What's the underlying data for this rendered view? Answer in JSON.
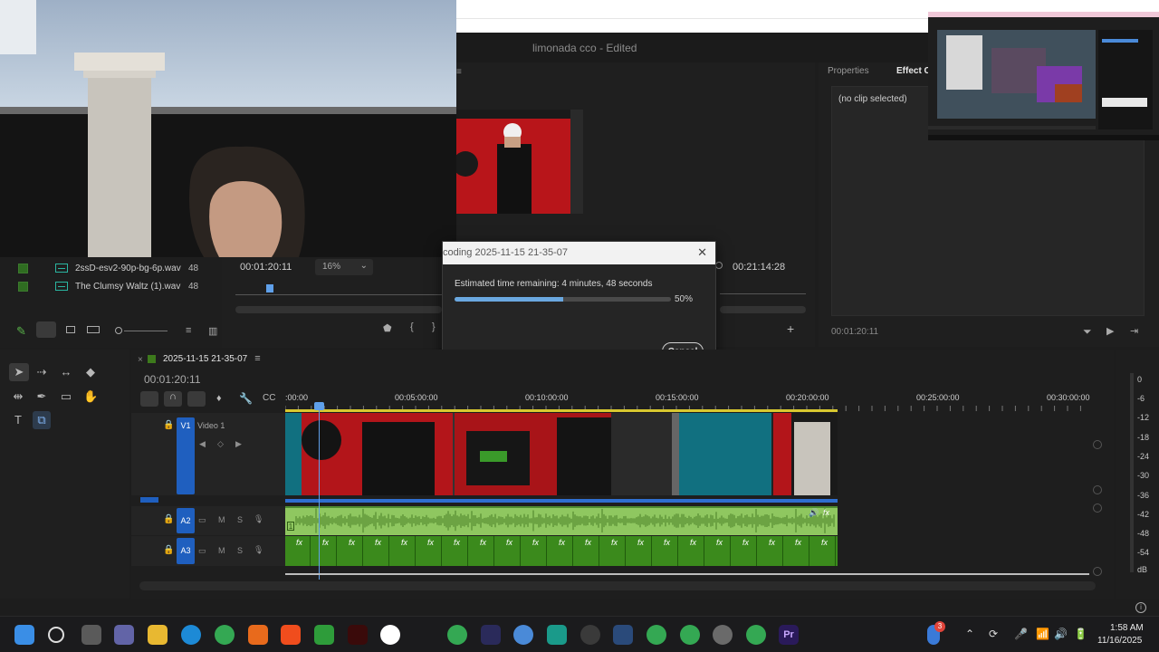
{
  "app": {
    "document_title": "limonada cco",
    "document_state": "- Edited"
  },
  "project": {
    "items": [
      {
        "name": "2ssD-esv2-90p-bg-6p.wav",
        "extra": "48"
      },
      {
        "name": "The Clumsy Waltz (1).wav",
        "extra": "48"
      }
    ]
  },
  "source_monitor": {
    "timecode": "00:01:20:11",
    "zoom": "16%"
  },
  "program_monitor": {
    "end_timecode": "00:21:14:28"
  },
  "properties": {
    "tabs": [
      "Properties",
      "Effect Co"
    ],
    "empty_message": "(no clip selected)",
    "timecode": "00:01:20:11"
  },
  "dialog": {
    "title": "coding 2025-11-15 21-35-07",
    "eta": "Estimated time remaining: 4 minutes, 48 seconds",
    "progress": 0.5,
    "progress_label": "50%",
    "cancel_label": "Cancel"
  },
  "timeline": {
    "sequence_name": "2025-11-15 21-35-07",
    "timecode": "00:01:20:11",
    "ruler_labels": [
      ":00:00",
      "00:05:00:00",
      "00:10:00:00",
      "00:15:00:00",
      "00:20:00:00",
      "00:25:00:00",
      "00:30:00:00"
    ],
    "tracks": {
      "v1": {
        "badge": "V1",
        "name": "Video 1"
      },
      "a2": {
        "badge": "A2",
        "m": "M",
        "s": "S"
      },
      "a3": {
        "badge": "A3",
        "m": "M",
        "s": "S"
      }
    },
    "fx_label": "fx",
    "audio_badge": "1"
  },
  "meters": {
    "labels": [
      "0",
      "-6",
      "-12",
      "-18",
      "-24",
      "-30",
      "-36",
      "-42",
      "-48",
      "-54",
      "dB"
    ]
  },
  "taskbar": {
    "time": "1:58 AM",
    "date": "11/16/2025",
    "notification_count": "3"
  },
  "colors": {
    "accent_blue": "#1f5fbf",
    "progress_blue": "#6aa8e0",
    "audio_green": "#8fc760",
    "fx_green": "#3b8a1c",
    "ruler_yellow": "#d8c82f"
  }
}
